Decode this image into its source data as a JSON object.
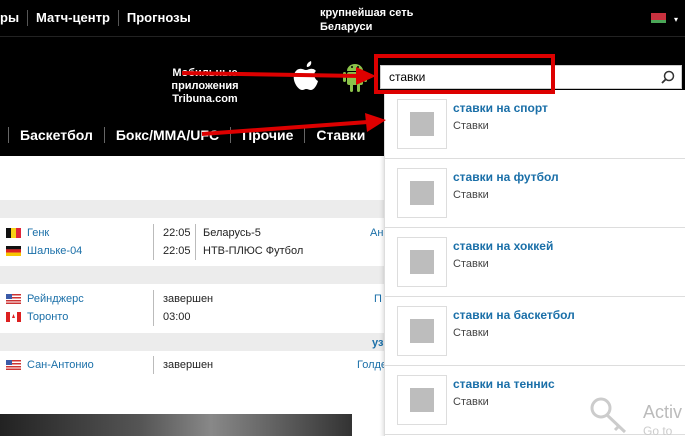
{
  "topbar": {
    "nav": [
      "ры",
      "Матч-центр",
      "Прогнозы"
    ],
    "tagline_line1": "крупнейшая сеть",
    "tagline_line2": "Беларуси"
  },
  "apps": {
    "line1": "Мобильные приложения",
    "line2": "Tribuna.com"
  },
  "search": {
    "value": "ставки"
  },
  "sportnav": [
    "Баскетбол",
    "Бокс/MMA/UFC",
    "Прочие",
    "Ставки"
  ],
  "matches": [
    {
      "team": "Генк",
      "time": "22:05",
      "tv": "Беларусь-5",
      "extra": "Ан"
    },
    {
      "team": "Шальке-04",
      "time": "22:05",
      "tv": "НТВ-ПЛЮС Футбол",
      "extra": ""
    },
    {
      "team": "Рейнджерс",
      "time": "завершен",
      "tv": "",
      "extra": "П"
    },
    {
      "team": "Торонто",
      "time": "03:00",
      "tv": "",
      "extra": ""
    },
    {
      "team": "Сан-Антонио",
      "time": "завершен",
      "tv": "",
      "extra": "Голде"
    }
  ],
  "side_tag": "узі",
  "suggestions": [
    {
      "title": "ставки на спорт",
      "sub": "Ставки"
    },
    {
      "title": "ставки на футбол",
      "sub": "Ставки"
    },
    {
      "title": "ставки на хоккей",
      "sub": "Ставки"
    },
    {
      "title": "ставки на баскетбол",
      "sub": "Ставки"
    },
    {
      "title": "ставки на теннис",
      "sub": "Ставки"
    }
  ],
  "watermark": {
    "line1": "Activ",
    "line2": "Go to"
  },
  "colors": {
    "link": "#1a6fa8",
    "annotation": "#dd0000",
    "bar": "#000000"
  }
}
